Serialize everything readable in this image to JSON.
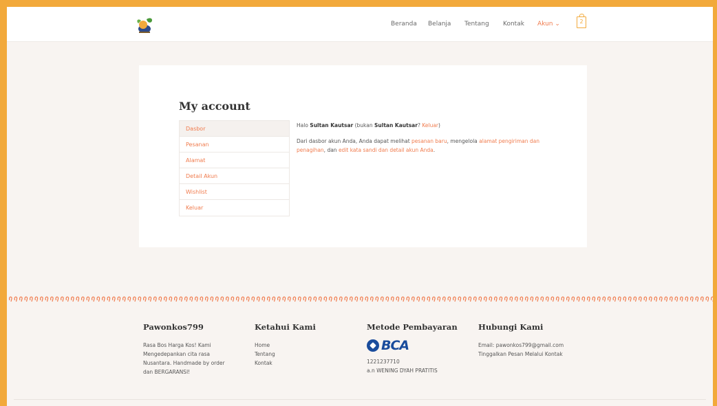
{
  "header": {
    "nav": [
      {
        "label": "Beranda"
      },
      {
        "label": "Belanja"
      },
      {
        "label": "Tentang"
      },
      {
        "label": "Kontak"
      },
      {
        "label": "Akun ⌄"
      }
    ],
    "cart_count": "2"
  },
  "main": {
    "title": "My account",
    "account_nav": [
      "Dasbor",
      "Pesanan",
      "Alamat",
      "Detail Akun",
      "Wishlist",
      "Keluar"
    ],
    "greeting": {
      "hello": "Halo ",
      "user": "Sultan Kautsar",
      "not_prefix": " (bukan ",
      "user2": "Sultan Kautsar",
      "not_q": "? ",
      "logout": "Keluar",
      "close": ")"
    },
    "intro": {
      "t1": "Dari dasbor akun Anda, Anda dapat melihat ",
      "l1": "pesanan baru",
      "t2": ", mengelola ",
      "l2": "alamat pengiriman dan penagihan",
      "t3": ", dan ",
      "l3": "edit kata sandi dan detail akun Anda",
      "t4": "."
    }
  },
  "footer": {
    "brand": {
      "title": "Pawonkos799",
      "text": [
        "Rasa Bos Harga Kos! Kami",
        "Mengedepankan cita rasa",
        "Nusantara. Handmade by order",
        "dan BERGARANSI!"
      ]
    },
    "about": {
      "title": "Ketahui Kami",
      "links": [
        "Home",
        "Tentang",
        "Kontak"
      ]
    },
    "payment": {
      "title": "Metode Pembayaran",
      "bank": "BCA",
      "account_number": "1221237710",
      "account_name": "a.n WENING DYAH PRATITIS"
    },
    "contact": {
      "title": "Hubungi Kami",
      "email": "Email: pawonkos799@gmail.com",
      "note": "Tinggalkan Pesan Melalui Kontak"
    }
  },
  "colors": {
    "accent": "#f07b4d",
    "frame": "#f2a93b",
    "bca_blue": "#1a4c9c"
  }
}
